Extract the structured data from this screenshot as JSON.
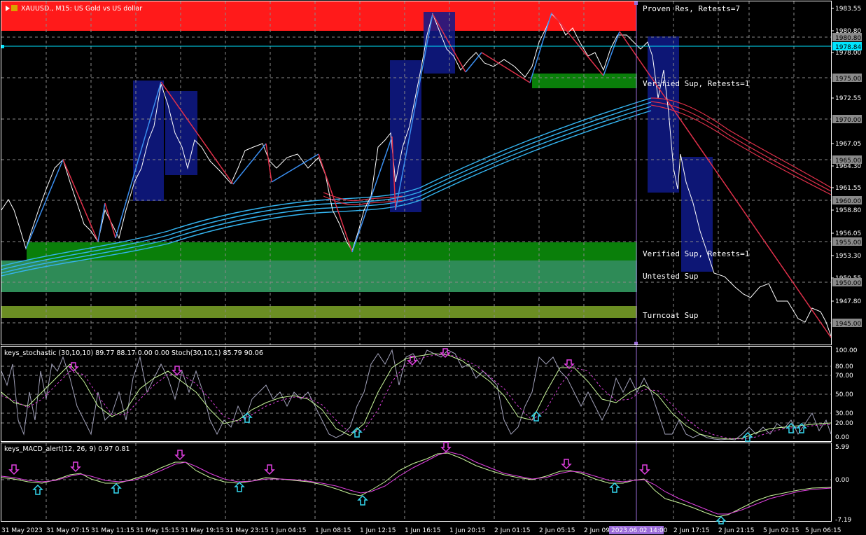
{
  "window": {
    "symbol_title": "XAUUSD., M15:  US Gold vs US dollar"
  },
  "zones": {
    "proven_res": "Proven Res, Retests=7",
    "verified_sup_1": "Verified Sup, Retests=1",
    "verified_sup_2": "Verified Sup, Retests=1",
    "untested_sup": "Untested Sup",
    "turncoat_sup": "Turncoat Sup"
  },
  "indicators": {
    "stochastic_label": "keys_stochastic (30,10,10) 89.77 88.17 0.00 0.00 Stoch(30,10,1) 85.79 90.06",
    "macd_label": "keys_MACD_alert(12, 26, 9) 0.97 0.81"
  },
  "price_axis": {
    "ticks": [
      "1983.55",
      "1980.80",
      "1978.00",
      "1975.00",
      "1972.55",
      "1970.00",
      "1967.05",
      "1965.00",
      "1964.30",
      "1961.55",
      "1960.00",
      "1958.80",
      "1956.05",
      "1955.00",
      "1953.30",
      "1950.55",
      "1950.00",
      "1947.80",
      "1945.00"
    ],
    "boxed": [
      "1980.80",
      "1975.00",
      "1970.00",
      "1965.00",
      "1960.00",
      "1955.00",
      "1950.00",
      "1945.00"
    ],
    "current_price": "1978.84"
  },
  "stoch_axis": {
    "ticks": [
      "100.00",
      "80.00",
      "70.00",
      "50.00",
      "30.00",
      "20.00",
      "0.00"
    ]
  },
  "macd_axis": {
    "ticks": [
      "5.99",
      "0.00",
      "-7.19"
    ]
  },
  "time_axis": {
    "labels": [
      "31 May 2023",
      "31 May 07:15",
      "31 May 11:15",
      "31 May 15:15",
      "31 May 19:15",
      "31 May 23:15",
      "1 Jun 04:15",
      "1 Jun 08:15",
      "1 Jun 12:15",
      "1 Jun 16:15",
      "1 Jun 20:15",
      "2 Jun 01:15",
      "2 Jun 05:15",
      "2 Jun 09:15",
      "2 Jun 17:15",
      "2 Jun 21:15",
      "5 Jun 02:15",
      "5 Jun 06:15"
    ],
    "crosshair_label": "2023.06.02 14:00"
  },
  "colors": {
    "background": "#000000",
    "resistance_zone": "#ff1a1a",
    "support_zone": "#0a7f0a",
    "untested_zone": "#2e8b57",
    "turncoat_zone": "#6b8e23",
    "moving_averages": "#34b4f0",
    "red_lines": "#e0304a",
    "crosshair": "#9a6bd8"
  }
}
